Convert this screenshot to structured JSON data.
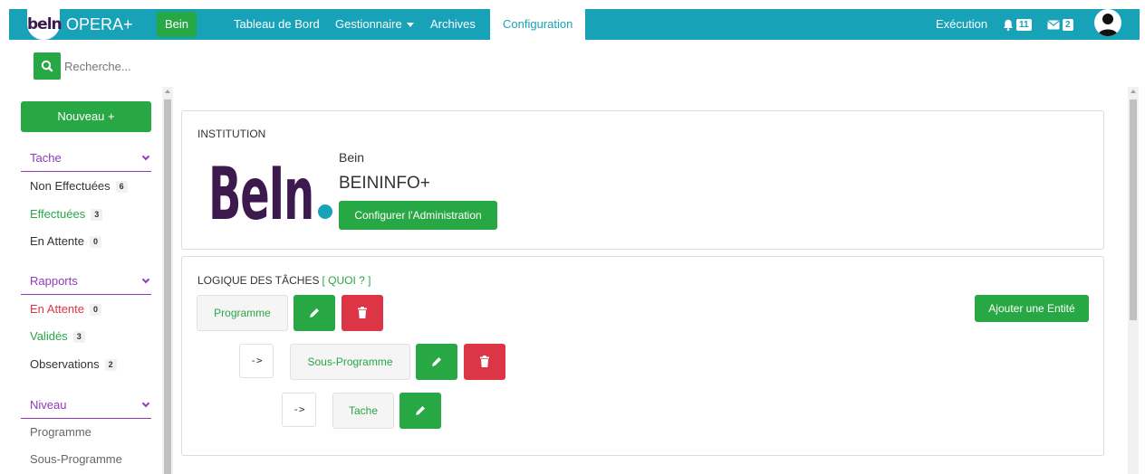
{
  "navbar": {
    "logo_mark": "beln",
    "app_name": "OPERA+",
    "org_badge": "Bein",
    "links": [
      {
        "label": "Tableau de Bord"
      },
      {
        "label": "Gestionnaire"
      },
      {
        "label": "Archives"
      },
      {
        "label": "Configuration",
        "active": true
      }
    ],
    "execution_label": "Exécution",
    "notifications_count": "11",
    "messages_count": "2",
    "accent_color": "#17a2b8"
  },
  "search": {
    "placeholder": "Recherche..."
  },
  "sidebar": {
    "new_button": "Nouveau +",
    "sections": [
      {
        "title": "Tache",
        "items": [
          {
            "label": "Non Effectuées",
            "count": "6"
          },
          {
            "label": "Effectuées",
            "count": "3"
          },
          {
            "label": "En Attente",
            "count": "0"
          }
        ]
      },
      {
        "title": "Rapports",
        "items": [
          {
            "label": "En Attente",
            "count": "0"
          },
          {
            "label": "Validés",
            "count": "3"
          },
          {
            "label": "Observations",
            "count": "2"
          }
        ]
      },
      {
        "title": "Niveau",
        "items": [
          {
            "label": "Programme"
          },
          {
            "label": "Sous-Programme"
          }
        ]
      }
    ]
  },
  "institution": {
    "section_title": "INSTITUTION",
    "logo_text": "BeIn",
    "short_name": "Bein",
    "full_name": "BEININFO+",
    "configure_button": "Configurer l'Administration"
  },
  "task_logic": {
    "title": "LOGIQUE DES TÂCHES",
    "help_link": "[ QUOI ? ]",
    "add_entity_button": "Ajouter une Entité",
    "arrow_label": "->",
    "entities": [
      {
        "label": "Programme"
      },
      {
        "label": "Sous-Programme"
      },
      {
        "label": "Tache"
      }
    ]
  },
  "colors": {
    "primary_green": "#28a745",
    "danger_red": "#dc3545",
    "section_purple": "#8e3ab8",
    "logo_purple": "#3d1a4d",
    "logo_dot": "#17a2b8"
  }
}
